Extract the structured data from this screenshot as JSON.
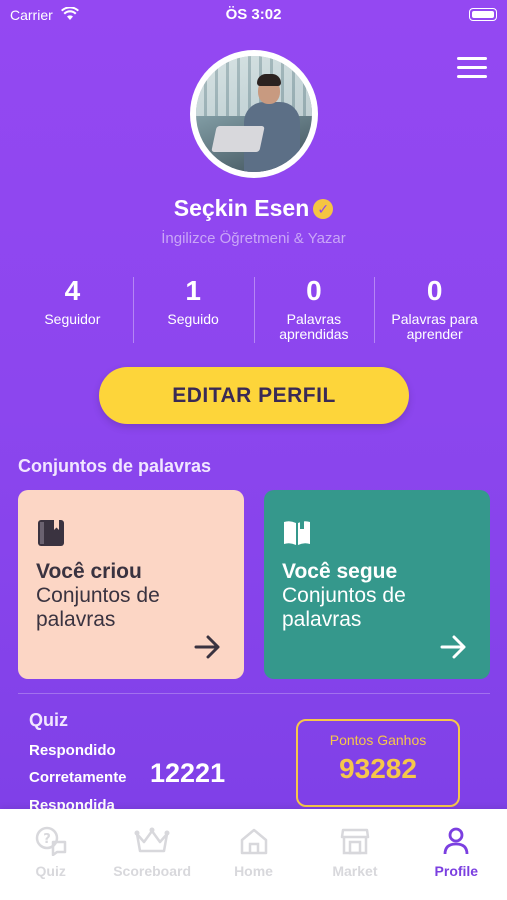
{
  "status_bar": {
    "carrier": "Carrier",
    "time": "ÖS 3:02"
  },
  "profile": {
    "name": "Seçkin Esen",
    "subtitle": "İngilizce Öğretmeni & Yazar",
    "verified_icon": "check-badge-icon"
  },
  "stats": [
    {
      "value": "4",
      "label": "Seguidor"
    },
    {
      "value": "1",
      "label": "Seguido"
    },
    {
      "value": "0",
      "label": "Palavras aprendidas"
    },
    {
      "value": "0",
      "label": "Palavras para aprender"
    }
  ],
  "edit_button": "EDITAR PERFIL",
  "section": {
    "title": "Conjuntos de palavras"
  },
  "cards": [
    {
      "title": "Você criou",
      "subtitle": "Conjuntos de palavras",
      "icon": "book-icon",
      "color": "#fcd6c5"
    },
    {
      "title": "Você segue",
      "subtitle": "Conjuntos de palavras",
      "icon": "open-book-icon",
      "color": "#35988c"
    }
  ],
  "quiz": {
    "title": "Quiz",
    "line1": "Respondido",
    "line2": "Corretamente",
    "value": "12221",
    "line3": "Respondida"
  },
  "points": {
    "label": "Pontos Ganhos",
    "value": "93282"
  },
  "tabs": [
    {
      "label": "Quiz",
      "icon": "quiz-chat-icon"
    },
    {
      "label": "Scoreboard",
      "icon": "crown-icon"
    },
    {
      "label": "Home",
      "icon": "home-icon"
    },
    {
      "label": "Market",
      "icon": "store-icon"
    },
    {
      "label": "Profile",
      "icon": "person-icon",
      "active": true
    }
  ],
  "colors": {
    "background": "#8c46ee",
    "accent_yellow": "#fdd53a",
    "card_peach": "#fcd6c5",
    "card_teal": "#35988c",
    "tab_active": "#7b3fe0"
  }
}
